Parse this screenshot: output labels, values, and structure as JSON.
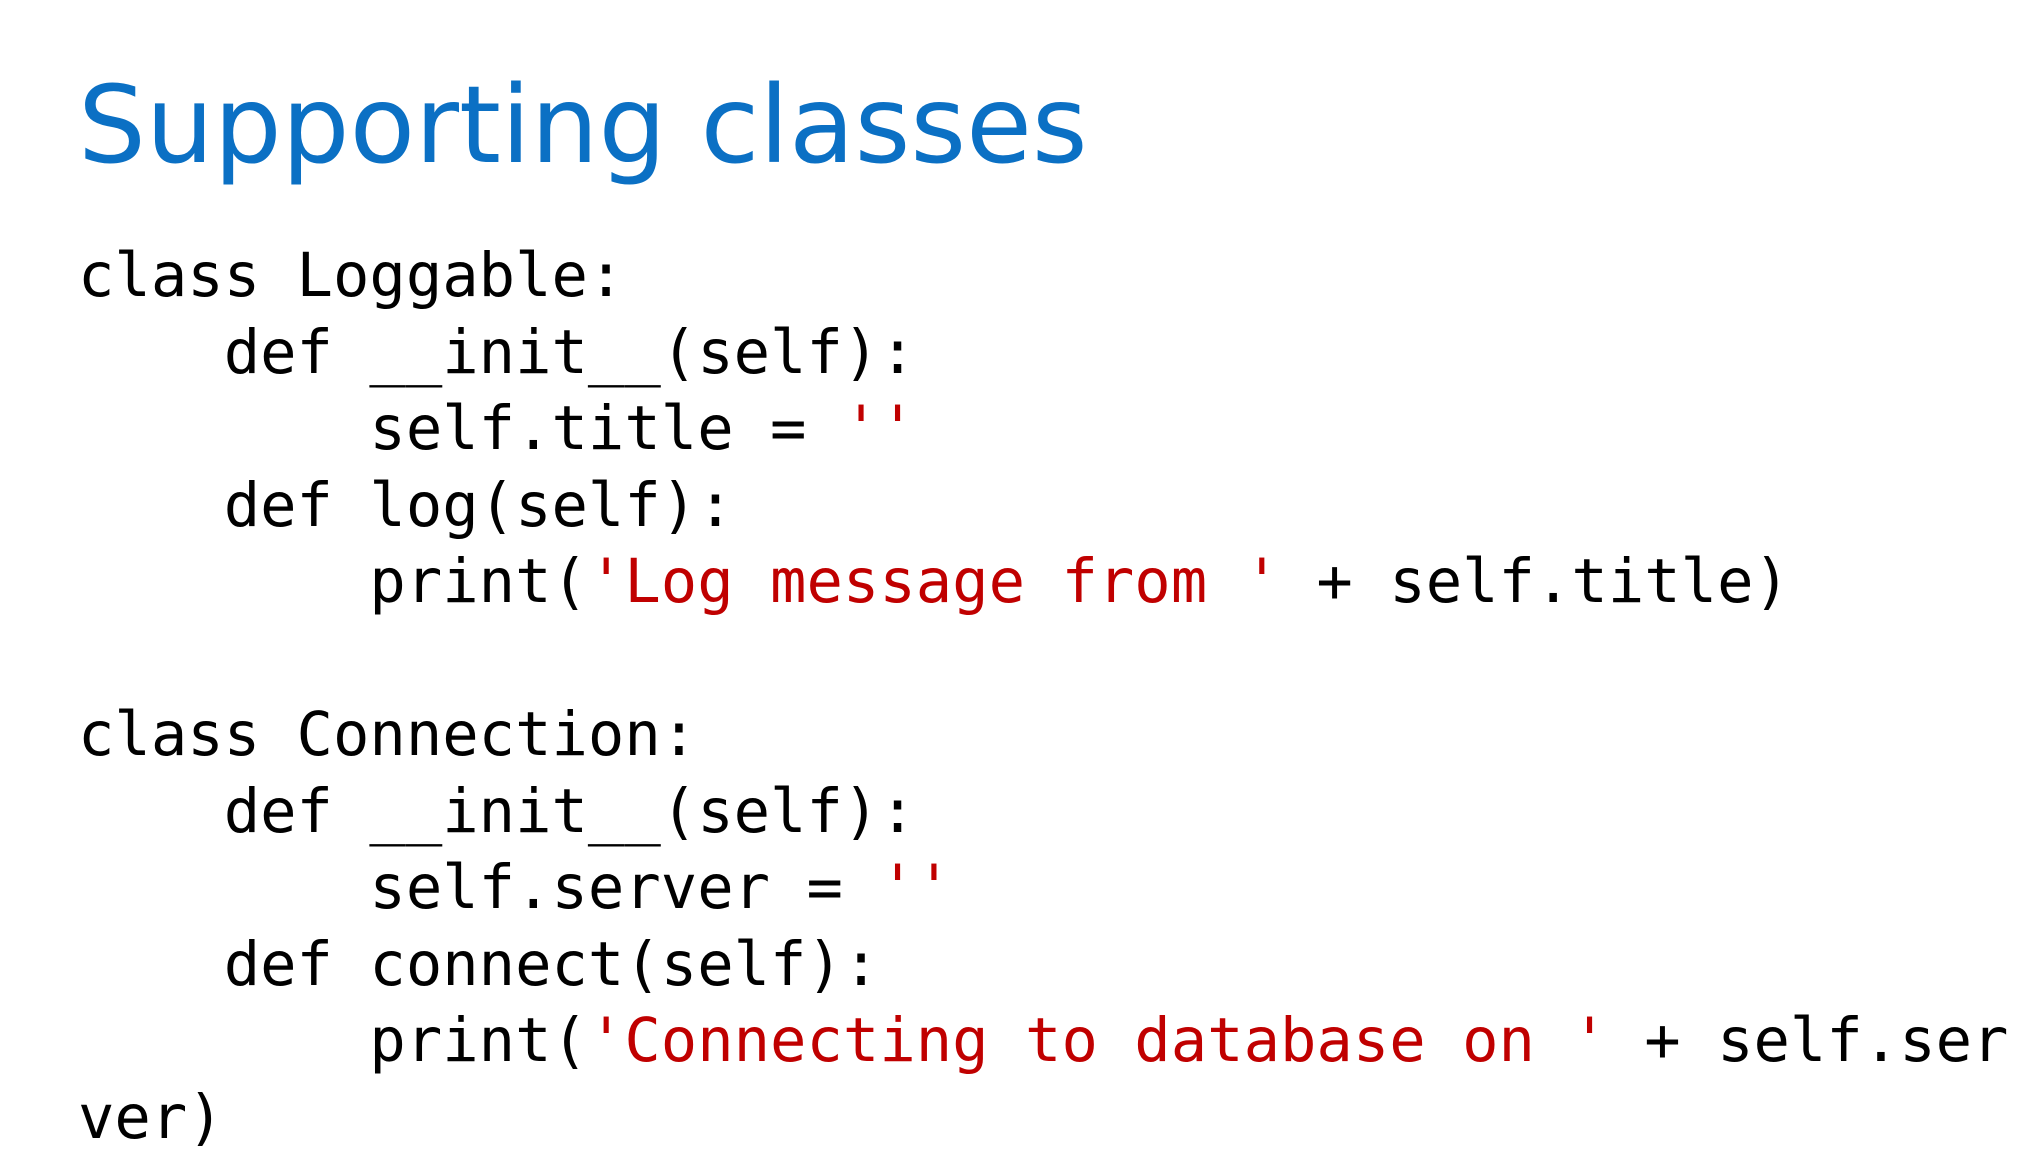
{
  "slide": {
    "title": "Supporting classes",
    "code_lines": [
      [
        {
          "text": "class Loggable:"
        }
      ],
      [
        {
          "text": "    def __init__(self):"
        }
      ],
      [
        {
          "text": "        self.title = "
        },
        {
          "text": "''",
          "kind": "string"
        }
      ],
      [
        {
          "text": "    def log(self):"
        }
      ],
      [
        {
          "text": "        print("
        },
        {
          "text": "'Log message from '",
          "kind": "string"
        },
        {
          "text": " + self.title)"
        }
      ],
      [],
      [
        {
          "text": "class Connection:"
        }
      ],
      [
        {
          "text": "    def __init__(self):"
        }
      ],
      [
        {
          "text": "        self.server = "
        },
        {
          "text": "''",
          "kind": "string"
        }
      ],
      [
        {
          "text": "    def connect(self):"
        }
      ],
      [
        {
          "text": "        print("
        },
        {
          "text": "'Connecting to database on '",
          "kind": "string"
        },
        {
          "text": " + self.ser"
        }
      ],
      [
        {
          "text": "ver)"
        }
      ]
    ]
  },
  "colors": {
    "title": "#0b70c4",
    "code_text": "#000000",
    "string_literal": "#c00000",
    "background": "#ffffff"
  }
}
